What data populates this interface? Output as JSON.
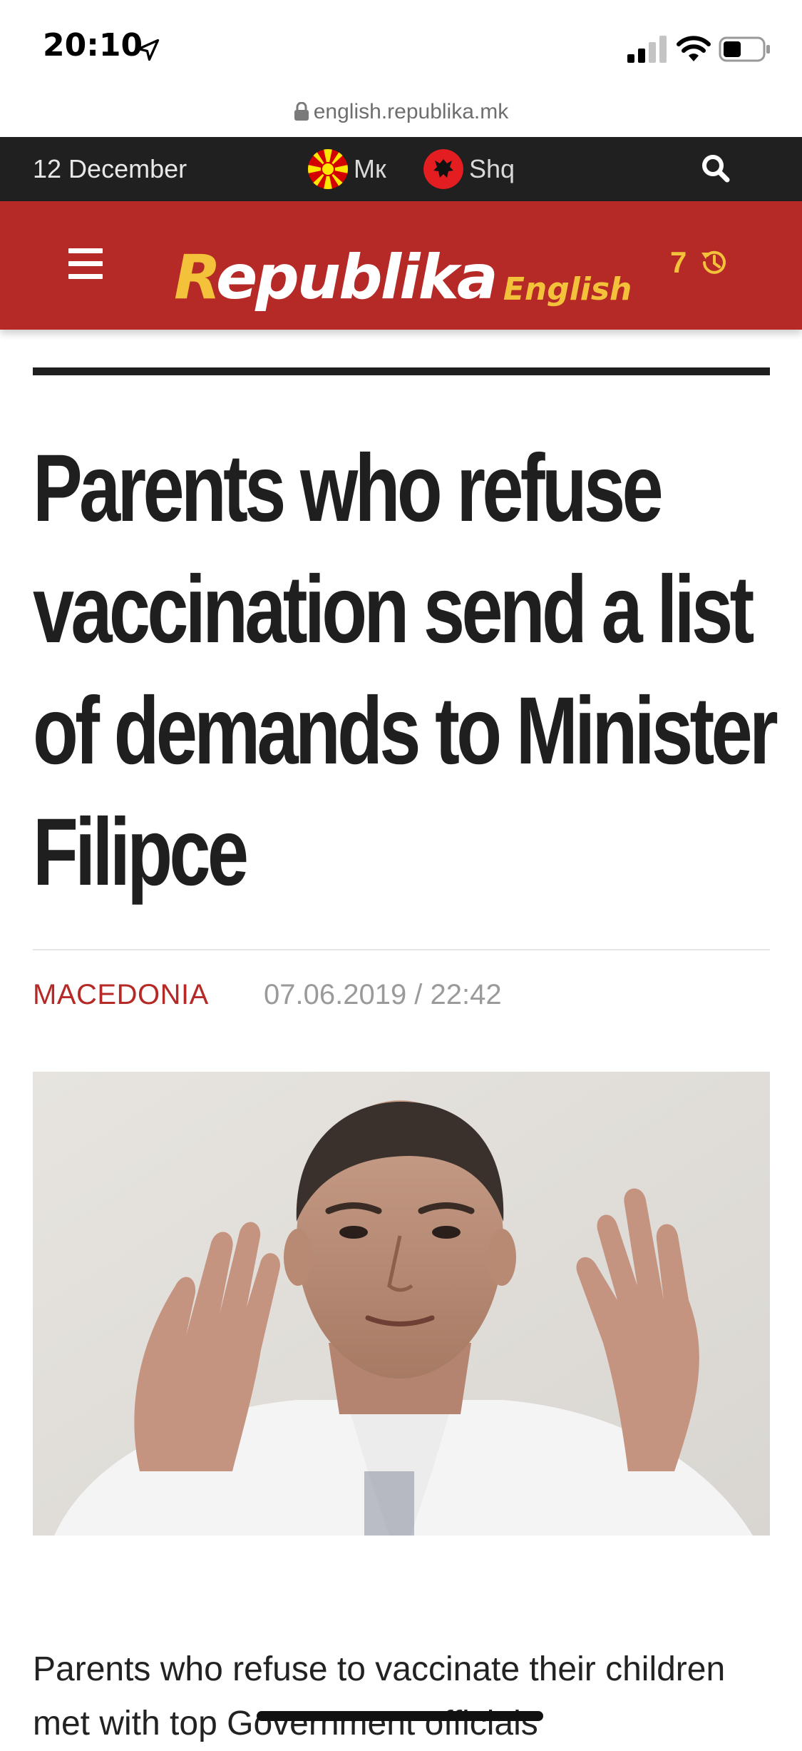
{
  "status_bar": {
    "time": "20:10"
  },
  "browser": {
    "url": "english.republika.mk"
  },
  "top_bar": {
    "date": "12 December",
    "languages": [
      {
        "label": "Мк"
      },
      {
        "label": "Shq"
      }
    ]
  },
  "header": {
    "logo_main": "epublika",
    "logo_initial": "R",
    "logo_sub": "English",
    "history_count": "7"
  },
  "article": {
    "headline": "Parents who refuse vaccination send a list of demands to Minister Filipce",
    "category": "MACEDONIA",
    "datetime": "07.06.2019 / 22:42",
    "body_start": "Parents who refuse to vaccinate their children met with top Government officials"
  },
  "colors": {
    "brand_red": "#b52a27",
    "brand_yellow": "#f3c23a",
    "top_bar": "#202020"
  },
  "icons": {
    "location": "location-arrow-icon",
    "signal": "cellular-signal-icon",
    "wifi": "wifi-icon",
    "battery": "battery-icon",
    "lock": "lock-icon",
    "search": "search-icon",
    "menu": "hamburger-menu-icon",
    "history": "history-clock-icon"
  }
}
